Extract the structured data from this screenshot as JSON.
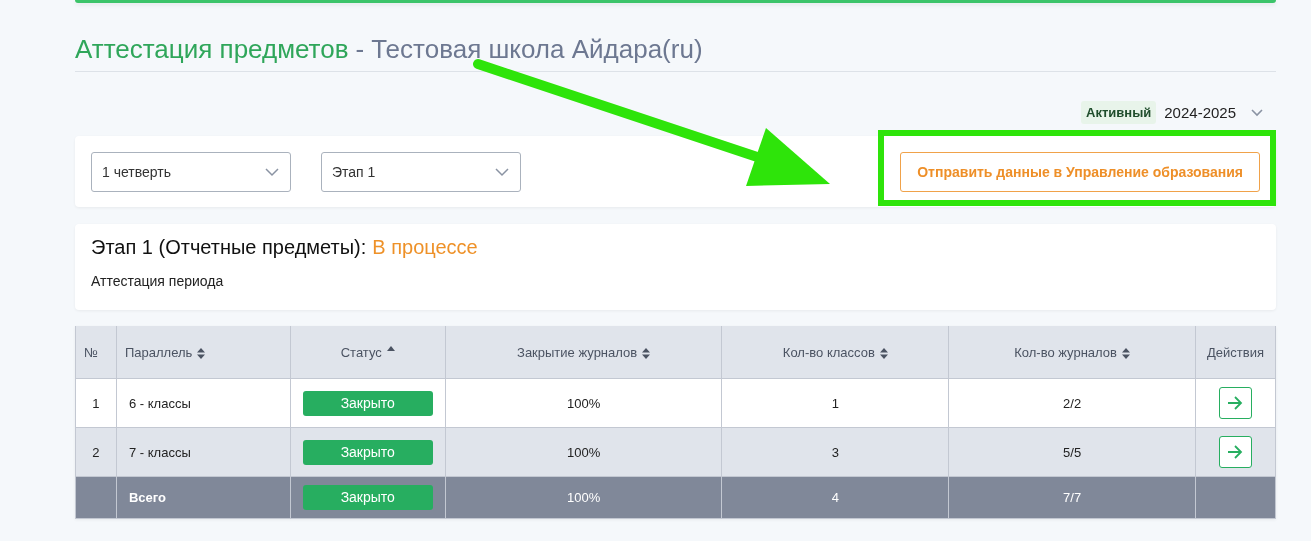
{
  "header": {
    "title": "Аттестация предметов",
    "separator": "-",
    "school": "Тестовая школа Айдара(ru)"
  },
  "year_selector": {
    "badge": "Активный",
    "value": "2024-2025"
  },
  "filters": [
    {
      "value": "1 четверть"
    },
    {
      "value": "Этап 1"
    }
  ],
  "send_button": {
    "label": "Отправить данные в Управление образования"
  },
  "stage": {
    "title": "Этап 1 (Отчетные предметы):",
    "status": "В процессе",
    "subtitle": "Аттестация периода"
  },
  "table": {
    "columns": [
      {
        "label": "№",
        "sortable": false
      },
      {
        "label": "Параллель",
        "sortable": true,
        "sorted": false
      },
      {
        "label": "Статус",
        "sortable": true,
        "sorted": true
      },
      {
        "label": "Закрытие журналов",
        "sortable": true,
        "sorted": false
      },
      {
        "label": "Кол-во классов",
        "sortable": true,
        "sorted": false
      },
      {
        "label": "Кол-во журналов",
        "sortable": true,
        "sorted": false
      },
      {
        "label": "Действия",
        "sortable": false
      }
    ],
    "rows": [
      {
        "kind": "row",
        "number": "1",
        "parallel": "6 - классы",
        "status": "Закрыто",
        "closing": "100%",
        "classes": "1",
        "journals": "2/2",
        "action": true
      },
      {
        "kind": "row",
        "number": "2",
        "parallel": "7 - классы",
        "status": "Закрыто",
        "closing": "100%",
        "classes": "3",
        "journals": "5/5",
        "action": true
      },
      {
        "kind": "total",
        "parallel": "Всего",
        "status": "Закрыто",
        "closing": "100%",
        "classes": "4",
        "journals": "7/7",
        "action": false
      }
    ]
  },
  "annotations": {
    "arrow": true,
    "frame": true
  }
}
